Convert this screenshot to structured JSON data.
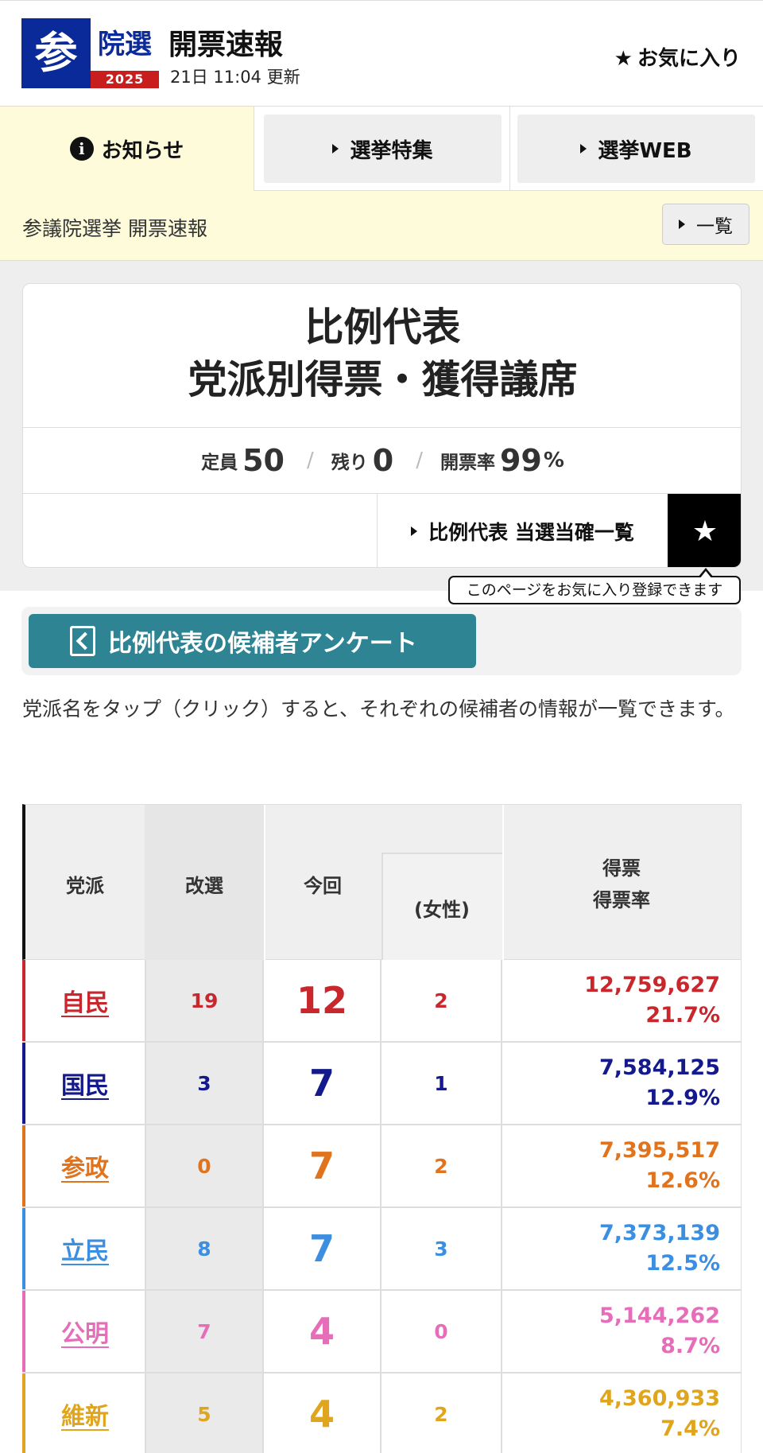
{
  "header": {
    "logo_kanji": "参",
    "logo_word": "院選",
    "logo_year": "2025",
    "title": "開票速報",
    "updated": "21日 11:04 更新",
    "favorite_label": "お気に入り"
  },
  "tabs": [
    {
      "label": "お知らせ",
      "active": true
    },
    {
      "label": "選挙特集"
    },
    {
      "label": "選挙WEB"
    }
  ],
  "notice": {
    "text": "参議院選挙 開票速報",
    "list_button": "一覧"
  },
  "card": {
    "title_line1": "比例代表",
    "title_line2": "党派別得票・獲得議席",
    "seats_label": "定員",
    "seats_value": "50",
    "remaining_label": "残り",
    "remaining_value": "0",
    "rate_label": "開票率",
    "rate_value": "99",
    "rate_unit": "%",
    "winners_link": "比例代表 当選当確一覧",
    "tooltip": "このページをお気に入り登録できます"
  },
  "survey": {
    "label": "比例代表の候補者アンケート"
  },
  "description": "党派名をタップ（クリック）すると、それぞれの候補者の情報が一覧できます。",
  "table": {
    "headers": {
      "party": "党派",
      "kaisen": "改選",
      "konkai": "今回",
      "josei": "(女性)",
      "votes_line1": "得票",
      "votes_line2": "得票率"
    },
    "rows": [
      {
        "party": "自民",
        "kaisen": "19",
        "konkai": "12",
        "josei": "2",
        "votes": "12,759,627",
        "rate": "21.7%",
        "color": "#c8282d"
      },
      {
        "party": "国民",
        "kaisen": "3",
        "konkai": "7",
        "josei": "1",
        "votes": "7,584,125",
        "rate": "12.9%",
        "color": "#14198c"
      },
      {
        "party": "参政",
        "kaisen": "0",
        "konkai": "7",
        "josei": "2",
        "votes": "7,395,517",
        "rate": "12.6%",
        "color": "#e0731e"
      },
      {
        "party": "立民",
        "kaisen": "8",
        "konkai": "7",
        "josei": "3",
        "votes": "7,373,139",
        "rate": "12.5%",
        "color": "#3c8fe0"
      },
      {
        "party": "公明",
        "kaisen": "7",
        "konkai": "4",
        "josei": "0",
        "votes": "5,144,262",
        "rate": "8.7%",
        "color": "#e66eb9"
      },
      {
        "party": "維新",
        "kaisen": "5",
        "konkai": "4",
        "josei": "2",
        "votes": "4,360,933",
        "rate": "7.4%",
        "color": "#e0a51e"
      }
    ]
  }
}
